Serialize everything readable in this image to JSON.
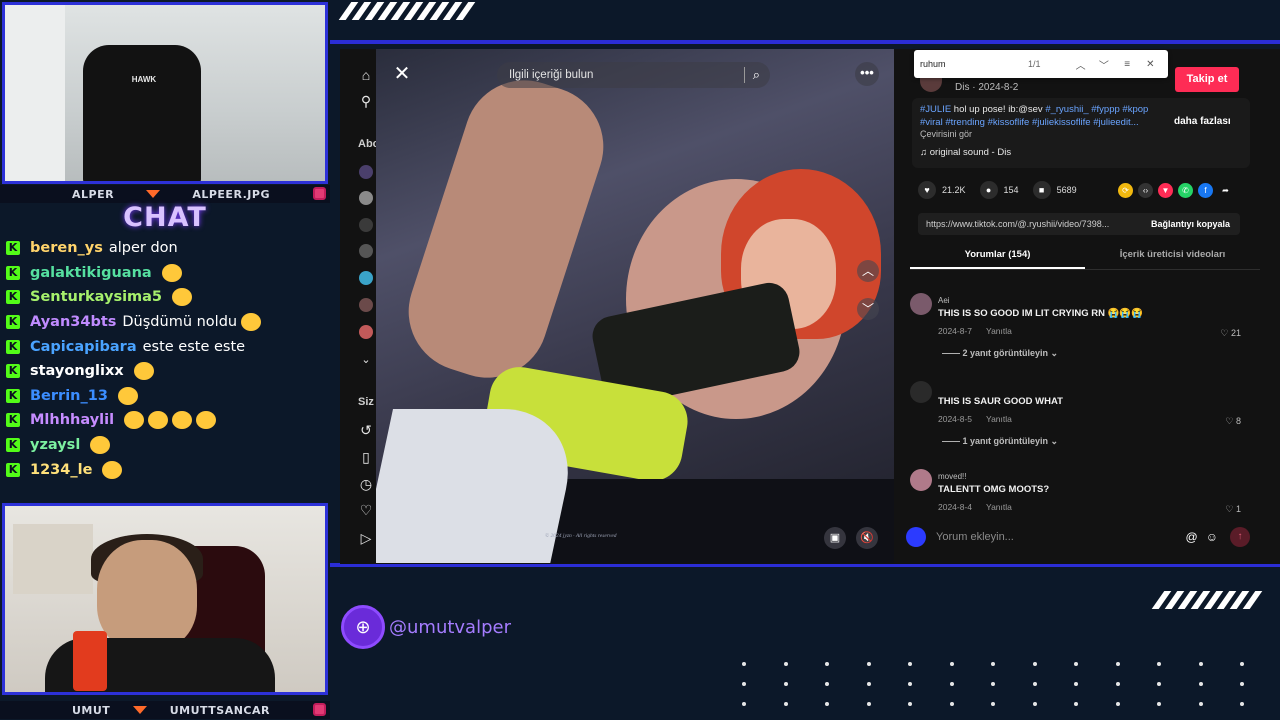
{
  "overlay": {
    "top_cam_left_name": "ALPER",
    "top_cam_right_name": "ALPEER.JPG",
    "bottom_cam_left_name": "UMUT",
    "bottom_cam_right_name": "UMUTTSANCAR",
    "chat_title": "CHAT",
    "chair_badge": "HAWK",
    "social_handle": "@umutvalper",
    "accent_color": "#2b2dd6",
    "kick_color": "#53fc18"
  },
  "chat": [
    {
      "user": "beren_ys",
      "color": "#ffd36b",
      "msg": "alper don",
      "emotes": 0
    },
    {
      "user": "galaktikiguana",
      "color": "#56e0a0",
      "msg": "",
      "emotes": 1
    },
    {
      "user": "Senturkaysima5",
      "color": "#a6f06c",
      "msg": "",
      "emotes": 1
    },
    {
      "user": "Ayan34bts",
      "color": "#c08bff",
      "msg": "Düşdümü noldu",
      "emotes": 1
    },
    {
      "user": "Capicapibara",
      "color": "#4aa3ff",
      "msg": "este este este",
      "emotes": 0
    },
    {
      "user": "stayonglixx",
      "color": "#ffffff",
      "msg": "",
      "emotes": 1
    },
    {
      "user": "Berrin_13",
      "color": "#3b8dff",
      "msg": "",
      "emotes": 1
    },
    {
      "user": "Mlhhhaylil",
      "color": "#c68cff",
      "msg": "",
      "emotes": 4
    },
    {
      "user": "yzaysl",
      "color": "#7cf0a0",
      "msg": "",
      "emotes": 1
    },
    {
      "user": "1234_le",
      "color": "#ffe07a",
      "msg": "",
      "emotes": 1
    }
  ],
  "tiktok": {
    "rail": {
      "home_icon": "home-icon",
      "explore_icon": "explore-icon",
      "section_following": "Abo",
      "section_you": "Siz"
    },
    "video": {
      "search_placeholder": "İlgili içeriği bulun",
      "caption_overlay": "© 2024 jyzn · All rights reserved"
    },
    "find_bar": {
      "query": "ruhum",
      "count": "1/1"
    },
    "author": {
      "subline": "Dis · 2024-8-2",
      "follow_label": "Takip et"
    },
    "description": {
      "text_lead": "#JULIE",
      "text_plain": " hol up pose! ib:@sev ",
      "tags": "#_ryushii_ #fyppp #kpop #viral #trending #kissoflife #juliekissoflife #julieedit...",
      "more": "daha fazlası",
      "translate": "Çevirisini gör",
      "sound": "original sound - Dis"
    },
    "stats": {
      "likes": "21.2K",
      "comments": "154",
      "saves": "5689"
    },
    "link": {
      "url": "https://www.tiktok.com/@.ryushii/video/7398...",
      "copy_label": "Bağlantıyı kopyala"
    },
    "tabs": [
      {
        "label": "Yorumlar (154)",
        "active": true
      },
      {
        "label": "İçerik üreticisi videoları",
        "active": false
      }
    ],
    "comments": [
      {
        "user": "Aei",
        "text": "THIS IS SO GOOD IM LIT CRYING RN 😭😭😭",
        "date": "2024-8-7",
        "reply": "Yanıtla",
        "likes": "21",
        "replies": "2 yanıt görüntüleyin"
      },
      {
        "user": "",
        "text": "THIS IS SAUR GOOD WHAT",
        "date": "2024-8-5",
        "reply": "Yanıtla",
        "likes": "8",
        "replies": "1 yanıt görüntüleyin"
      },
      {
        "user": "moved!!",
        "text": "TALENTT OMG MOOTS?",
        "date": "2024-8-4",
        "reply": "Yanıtla",
        "likes": "1",
        "replies": ""
      }
    ],
    "comment_placeholder": "Yorum ekleyin..."
  }
}
